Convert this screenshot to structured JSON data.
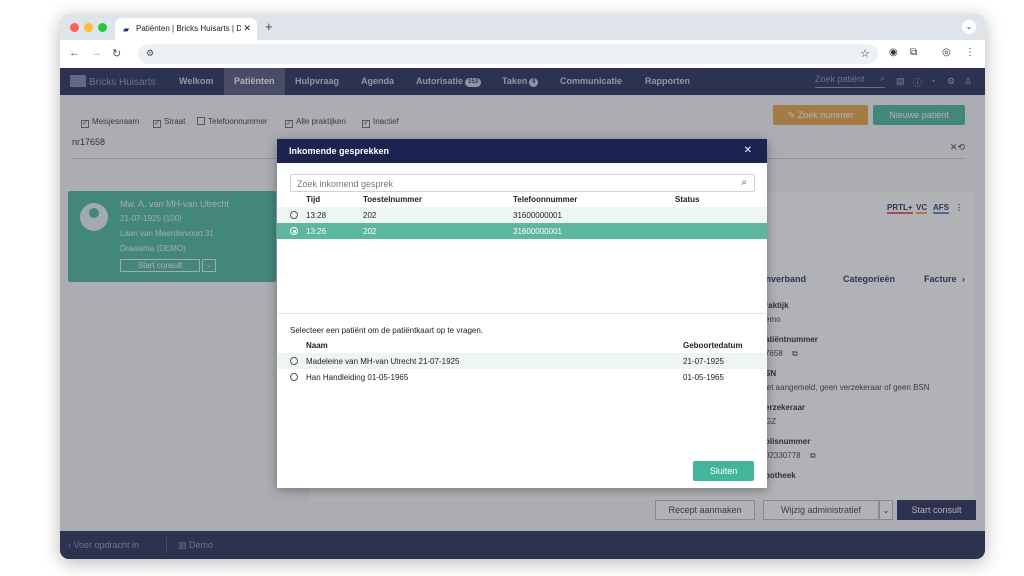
{
  "browser": {
    "tab_title": "Patiënten | Bricks Huisarts | D",
    "tab_close": "✕",
    "new_tab": "+",
    "tab_menu": "⌄"
  },
  "app": {
    "brand": "Bricks Huisarts",
    "nav": [
      {
        "label": "Welkom"
      },
      {
        "label": "Patiënten"
      },
      {
        "label": "Hulpvraag"
      },
      {
        "label": "Agenda"
      },
      {
        "label": "Autorisatie",
        "badge": "153"
      },
      {
        "label": "Taken",
        "badge": "8"
      },
      {
        "label": "Communicatie"
      },
      {
        "label": "Rapporten"
      }
    ],
    "search_placeholder": "Zoek patiënt"
  },
  "filters": {
    "items": [
      {
        "label": "Meisjesnaam",
        "checked": true
      },
      {
        "label": "Straat",
        "checked": true
      },
      {
        "label": "Telefoonnummer",
        "checked": false
      },
      {
        "label": "Alle praktijken",
        "checked": true
      },
      {
        "label": "Inactief",
        "checked": true
      }
    ],
    "search_value": "nr17658",
    "btn_zoek_nummer": "Zoek nummer",
    "btn_nieuwe_patient": "Nieuwe patiënt"
  },
  "patient_card": {
    "name": "Mw. A. van MH-van Utrecht",
    "dob": "21-07-1925 (100)",
    "address": "Laan van Meerdervoort 31",
    "practice": "Draaisma (DEMO)",
    "start_consult": "Start consult"
  },
  "detail": {
    "tags": [
      "PRTL+",
      "VC",
      "AFS"
    ],
    "tabs": [
      "onverband",
      "Categorieën",
      "Facture"
    ],
    "fields": [
      {
        "label": "raktijk",
        "value": "emo"
      },
      {
        "label": "atiëntnummer",
        "value": "7658"
      },
      {
        "label": "SN",
        "value": "iet aangemeld, geen verzekeraar of geen BSN"
      },
      {
        "label": "erzekeraar",
        "value": "GZ"
      },
      {
        "label": "olisnummer",
        "value": "02330778"
      },
      {
        "label": "potheek",
        "value": ""
      }
    ],
    "btn_recept": "Recept aanmaken",
    "btn_wijzig": "Wijzig administratief",
    "btn_start": "Start consult"
  },
  "footer": {
    "command": "Voer opdracht in",
    "location": "Demo"
  },
  "modal": {
    "title": "Inkomende gesprekken",
    "close": "✕",
    "search_placeholder": "Zoek inkomend gesprek",
    "call_headers": {
      "tijd": "Tijd",
      "toestel": "Toestelnummer",
      "telefoon": "Telefoonnummer",
      "status": "Status"
    },
    "calls": [
      {
        "tijd": "13:28",
        "toestel": "202",
        "telefoon": "31600000001",
        "status": "",
        "selected": false
      },
      {
        "tijd": "13:26",
        "toestel": "202",
        "telefoon": "31600000001",
        "status": "",
        "selected": true
      }
    ],
    "message": "Selecteer een patiënt om de patiëntkaart op te vragen.",
    "patient_headers": {
      "naam": "Naam",
      "geboortedatum": "Geboortedatum"
    },
    "patients": [
      {
        "naam": "Madeleine van MH-van Utrecht 21-07-1925",
        "geboortedatum": "21-07-1925"
      },
      {
        "naam": "Han Handleiding 01-05-1965",
        "geboortedatum": "01-05-1965"
      }
    ],
    "btn_sluiten": "Sluiten"
  },
  "colors": {
    "nav_bg": "#1c2350",
    "teal": "#43b59a",
    "orange": "#e8a33a",
    "selected_row": "#5bb89c"
  }
}
